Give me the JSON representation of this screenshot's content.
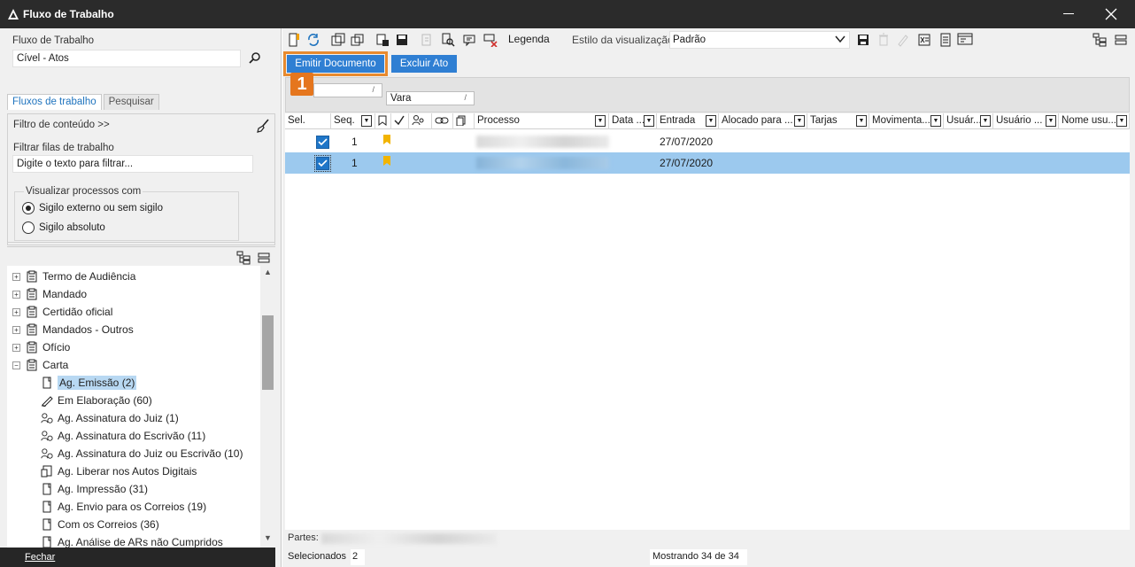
{
  "window": {
    "title": "Fluxo de Trabalho"
  },
  "left": {
    "fluxo_label": "Fluxo de Trabalho",
    "fluxo_value": "Cível - Atos",
    "tabs": [
      "Fluxos de trabalho",
      "Pesquisar"
    ],
    "filtro_conteudo": "Filtro de conteúdo >>",
    "filtrar_filas_label": "Filtrar filas de trabalho",
    "filtrar_filas_placeholder": "Digite o texto para filtrar...",
    "visualizar_label": "Visualizar processos com",
    "radio_options": [
      "Sigilo externo ou sem sigilo",
      "Sigilo absoluto"
    ],
    "radio_selected": 0,
    "tree": [
      {
        "label": "Termo de Audiência",
        "level": 0,
        "expander": "+"
      },
      {
        "label": "Mandado",
        "level": 0,
        "expander": "+"
      },
      {
        "label": "Certidão oficial",
        "level": 0,
        "expander": "+"
      },
      {
        "label": "Mandados - Outros",
        "level": 0,
        "expander": "+"
      },
      {
        "label": "Ofício",
        "level": 0,
        "expander": "+"
      },
      {
        "label": "Carta",
        "level": 0,
        "expander": "−"
      },
      {
        "label": "Ag. Emissão (2)",
        "level": 1,
        "selected": true
      },
      {
        "label": "Em Elaboração (60)",
        "level": 1
      },
      {
        "label": "Ag. Assinatura do Juiz (1)",
        "level": 1
      },
      {
        "label": "Ag. Assinatura do Escrivão (11)",
        "level": 1
      },
      {
        "label": "Ag. Assinatura do Juiz ou Escrivão (10)",
        "level": 1
      },
      {
        "label": "Ag. Liberar nos Autos Digitais",
        "level": 1
      },
      {
        "label": "Ag. Impressão (31)",
        "level": 1
      },
      {
        "label": "Ag. Envio para os Correios (19)",
        "level": 1
      },
      {
        "label": "Com os Correios (36)",
        "level": 1
      },
      {
        "label": "Ag. Análise de ARs não Cumpridos",
        "level": 1
      }
    ],
    "fechar": "Fechar"
  },
  "toolbar": {
    "legenda": "Legenda",
    "estilo_label": "Estilo da visualização",
    "estilo_value": "Padrão",
    "emitir": "Emitir Documento",
    "excluir": "Excluir Ato",
    "callout": "1"
  },
  "grouping": {
    "chip2": "Vara"
  },
  "grid": {
    "headers": [
      "Sel.",
      "Seq.",
      "Processo",
      "Data ...",
      "Entrada",
      "Alocado para ...",
      "Tarjas",
      "Movimenta...",
      "Usuár...",
      "Usuário ...",
      "Nome usu..."
    ],
    "rows": [
      {
        "seq": "1",
        "entrada": "27/07/2020",
        "selected": false,
        "checked": true
      },
      {
        "seq": "1",
        "entrada": "27/07/2020",
        "selected": true,
        "checked": true
      }
    ],
    "bookmark_color": "#f2b400"
  },
  "footer": {
    "partes": "Partes:",
    "selecionados": "Selecionados",
    "selecionados_count": "2",
    "mostrando": "Mostrando 34 de 34"
  }
}
